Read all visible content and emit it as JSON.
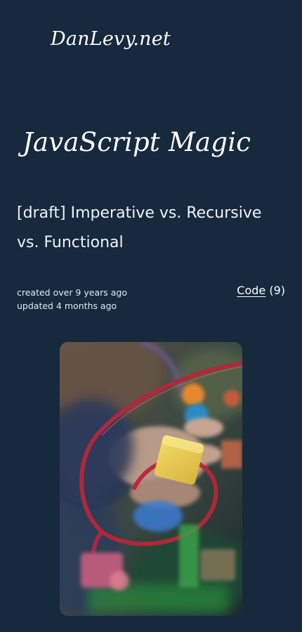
{
  "site": {
    "logo_text": "DanLevy.net"
  },
  "hero": {
    "category_title": "JavaScript Magic"
  },
  "post": {
    "title": "[draft] Imperative vs. Recursive vs. Functional",
    "created_text": "created over 9 years ago",
    "updated_text": "updated 4 months ago",
    "tag_label": "Code",
    "tag_count": "(9)"
  },
  "image": {
    "alt": "child playing with a bead maze toy"
  },
  "colors": {
    "background": "#16293d",
    "text": "#ffffff"
  }
}
